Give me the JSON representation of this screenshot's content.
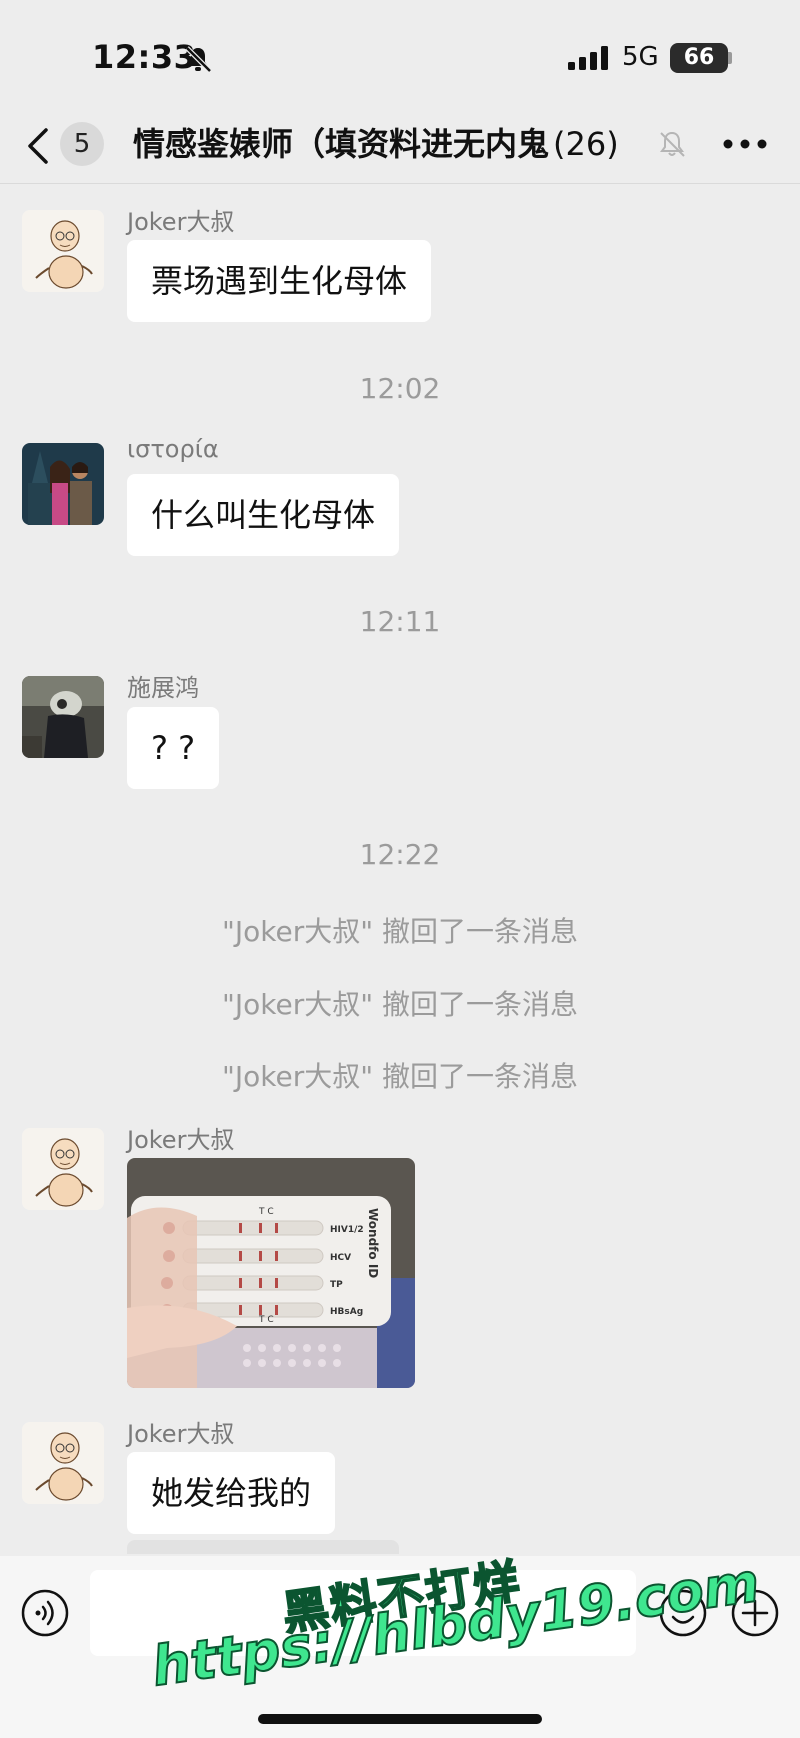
{
  "status_bar": {
    "time": "12:33",
    "network": "5G",
    "battery": "66"
  },
  "nav": {
    "unread_count": "5",
    "title": "情感鉴婊师（填资料进无内鬼",
    "member_count": "(26)"
  },
  "messages": [
    {
      "sender": "Joker大叔",
      "text": "票场遇到生化母体"
    },
    {
      "time": "12:02"
    },
    {
      "sender": "ιστορία",
      "text": "什么叫生化母体"
    },
    {
      "time": "12:11"
    },
    {
      "sender": "施展鸿",
      "text": "? ?"
    },
    {
      "time": "12:22"
    },
    {
      "system": "\"Joker大叔\" 撤回了一条消息"
    },
    {
      "system": "\"Joker大叔\" 撤回了一条消息"
    },
    {
      "system": "\"Joker大叔\" 撤回了一条消息"
    },
    {
      "sender": "Joker大叔",
      "image": {
        "brand": "Wondfo ID",
        "tests": [
          "HIV1/2",
          "HCV",
          "TP",
          "HBsAg"
        ],
        "header_tc": "T C",
        "footer_tc": "T C"
      }
    },
    {
      "sender": "Joker大叔",
      "text": "她发给我的"
    }
  ],
  "watermark": {
    "line1": "黑料不打烊",
    "line2": "https://hlbdy19.com"
  },
  "icons": {
    "back": "chevron-left-icon",
    "bell_off": "bell-off-icon",
    "mute": "bell-off-icon",
    "more": "more-dots-icon",
    "voice": "voice-icon",
    "emoji": "emoji-icon",
    "plus": "plus-icon"
  }
}
